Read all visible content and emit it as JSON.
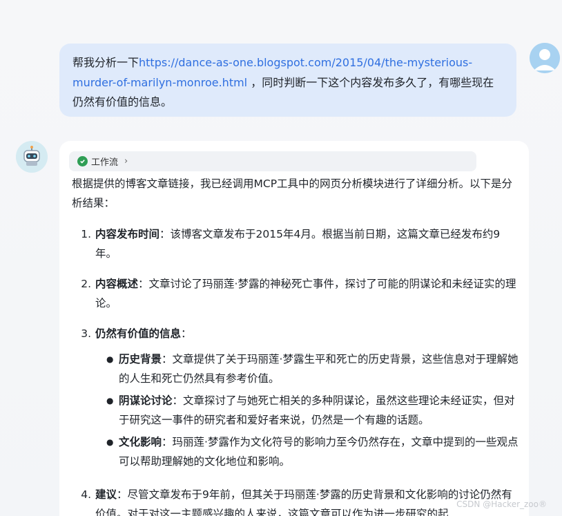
{
  "user": {
    "prefix": "帮我分析一下",
    "link": "https://dance-as-one.blogspot.com/2015/04/the-mysterious-murder-of-marilyn-monroe.html",
    "suffix": " ，同时判断一下这个内容发布多久了，有哪些现在仍然有价值的信息。"
  },
  "workflow_label": "工作流",
  "intro": "根据提供的博客文章链接，我已经调用MCP工具中的网页分析模块进行了详细分析。以下是分析结果：",
  "items": [
    {
      "num": "1.",
      "title": "内容发布时间",
      "text": "：该博客文章发布于2015年4月。根据当前日期，这篇文章已经发布约9年。"
    },
    {
      "num": "2.",
      "title": "内容概述",
      "text": "：文章讨论了玛丽莲·梦露的神秘死亡事件，探讨了可能的阴谋论和未经证实的理论。"
    },
    {
      "num": "3.",
      "title": "仍然有价值的信息",
      "text": "："
    },
    {
      "num": "4.",
      "title": "建议",
      "text": "：尽管文章发布于9年前，但其关于玛丽莲·梦露的历史背景和文化影响的讨论仍然有价值。对于对这一主题感兴趣的人来说，这篇文章可以作为进一步研究的起"
    }
  ],
  "sub_items": [
    {
      "title": "历史背景",
      "text": "：文章提供了关于玛丽莲·梦露生平和死亡的历史背景，这些信息对于理解她的人生和死亡仍然具有参考价值。"
    },
    {
      "title": "阴谋论讨论",
      "text": "：文章探讨了与她死亡相关的多种阴谋论，虽然这些理论未经证实，但对于研究这一事件的研究者和爱好者来说，仍然是一个有趣的话题。"
    },
    {
      "title": "文化影响",
      "text": "：玛丽莲·梦露作为文化符号的影响力至今仍然存在，文章中提到的一些观点可以帮助理解她的文化地位和影响。"
    }
  ],
  "watermark": "CSDN @Hacker_zoo®",
  "icons": {
    "user_avatar": "user-avatar-icon",
    "bot_avatar": "robot-icon",
    "check": "check-circle-icon",
    "chevron": "chevron-right-icon"
  },
  "colors": {
    "user_bubble": "#dfeafb",
    "link": "#2f6fe0",
    "check": "#2f9e55"
  }
}
